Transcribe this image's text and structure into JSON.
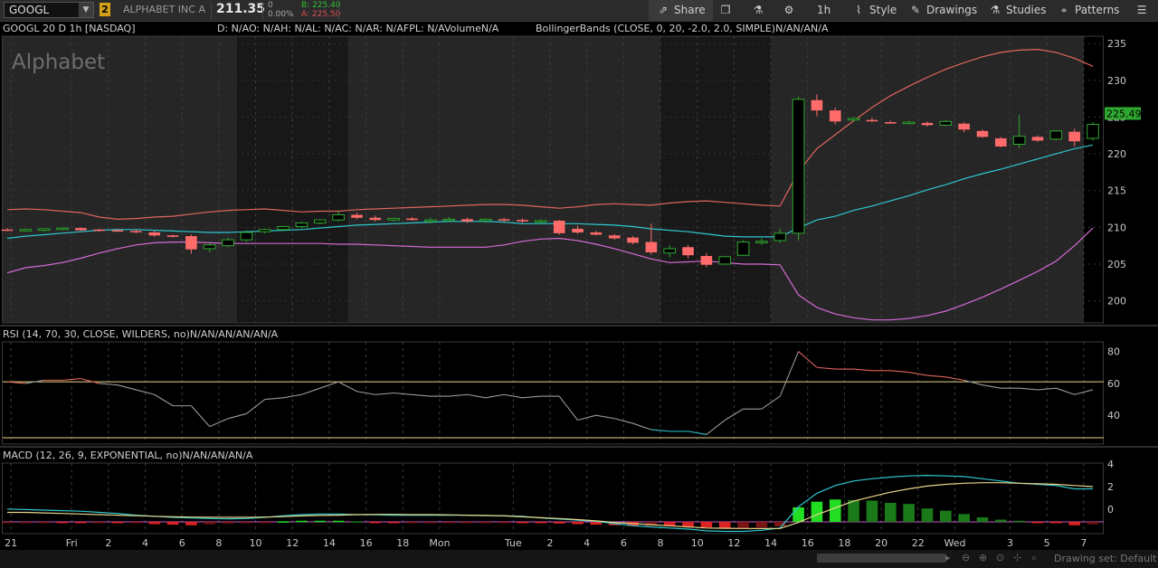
{
  "toolbar": {
    "symbol": "GOOGL",
    "link_badge": "2",
    "company": "ALPHABET INC A",
    "last_price": "211.35",
    "change": "0",
    "change_pct": "0.00%",
    "bid": "B: 225.40",
    "ask": "A: 225.50",
    "share_label": "Share",
    "timeframe_label": "1h",
    "style_label": "Style",
    "drawings_label": "Drawings",
    "studies_label": "Studies",
    "patterns_label": "Patterns",
    "icons": {
      "share": "share-icon",
      "window": "window-icon",
      "flask": "flask-icon",
      "settings": "gear-icon",
      "style": "style-icon",
      "drawings": "pencil-icon",
      "studies": "studies-icon",
      "patterns": "patterns-icon",
      "menu": "menu-icon"
    }
  },
  "header": {
    "chart_title": "GOOGL 20 D 1h [NASDAQ]",
    "quote_line": "D: N/AO: N/AH: N/AL: N/AC: N/AR: N/AFPL: N/AVolumeN/A",
    "study_line": "BollingerBands (CLOSE, 0, 20, -2.0, 2.0, SIMPLE)N/AN/AN/A",
    "watermark": "Alphabet"
  },
  "rsi_label": "RSI (14, 70, 30, CLOSE, WILDERS, no)N/AN/AN/AN/AN/A",
  "macd_label": "MACD (12, 26, 9, EXPONENTIAL, no)N/AN/AN/AN/A",
  "footer": {
    "drawing_set": "Drawing set: Default"
  },
  "colors": {
    "up": "#2fa82f",
    "down": "#ff6b6b",
    "bb_upper": "#e0655f",
    "bb_mid": "#2ec8d0",
    "bb_lower": "#d66ad6",
    "rsi": "#9a9a9a",
    "rsi_ob": "#e0655f",
    "rsi_os": "#2ec8d0",
    "band": "#e8d58a",
    "macd": "#2ec8d0",
    "signal": "#e8d58a",
    "hist_up": "#22dd22",
    "hist_up_dim": "#1a7a1a",
    "hist_dn": "#dd2222",
    "hist_dn_dim": "#7a1515"
  },
  "chart_data": [
    {
      "type": "candlestick",
      "title": "GOOGL 20 D 1h [NASDAQ]",
      "ylim": [
        197,
        236
      ],
      "y_ticks": [
        200,
        205,
        210,
        215,
        220,
        225,
        230,
        235
      ],
      "x_tick_labels": [
        "21",
        "Fri",
        "2",
        "4",
        "6",
        "8",
        "10",
        "12",
        "14",
        "16",
        "18",
        "Mon",
        "Tue",
        "2",
        "4",
        "6",
        "8",
        "10",
        "12",
        "14",
        "16",
        "18",
        "20",
        "22",
        "Wed",
        "3",
        "5",
        "7"
      ],
      "last_price_label": "225.49",
      "sessions": [
        {
          "type": "extended",
          "start": 0,
          "end": 13
        },
        {
          "type": "overnight",
          "start": 13,
          "end": 19
        },
        {
          "type": "regular",
          "start": 19,
          "end": 36
        },
        {
          "type": "overnight",
          "start": 36,
          "end": 42
        },
        {
          "type": "extended",
          "start": 42,
          "end": 59
        }
      ],
      "candles": [
        {
          "o": 209.7,
          "h": 209.9,
          "l": 209.5,
          "c": 209.6
        },
        {
          "o": 209.6,
          "h": 209.8,
          "l": 209.4,
          "c": 209.7
        },
        {
          "o": 209.6,
          "h": 209.9,
          "l": 209.4,
          "c": 209.8
        },
        {
          "o": 209.8,
          "h": 210.0,
          "l": 209.6,
          "c": 209.9
        },
        {
          "o": 209.9,
          "h": 210.0,
          "l": 209.5,
          "c": 209.6
        },
        {
          "o": 209.7,
          "h": 209.8,
          "l": 209.4,
          "c": 209.6
        },
        {
          "o": 209.6,
          "h": 209.8,
          "l": 209.4,
          "c": 209.5
        },
        {
          "o": 209.5,
          "h": 209.7,
          "l": 209.2,
          "c": 209.4
        },
        {
          "o": 209.3,
          "h": 209.5,
          "l": 208.7,
          "c": 208.9
        },
        {
          "o": 208.9,
          "h": 209.0,
          "l": 208.6,
          "c": 208.7
        },
        {
          "o": 208.8,
          "h": 209.0,
          "l": 206.4,
          "c": 207.0
        },
        {
          "o": 207.1,
          "h": 207.8,
          "l": 206.6,
          "c": 207.6
        },
        {
          "o": 207.5,
          "h": 208.6,
          "l": 207.3,
          "c": 208.3
        },
        {
          "o": 208.3,
          "h": 209.6,
          "l": 208.0,
          "c": 209.3
        },
        {
          "o": 209.4,
          "h": 209.8,
          "l": 209.2,
          "c": 209.7
        },
        {
          "o": 209.7,
          "h": 210.2,
          "l": 209.5,
          "c": 210.1
        },
        {
          "o": 210.1,
          "h": 210.7,
          "l": 209.9,
          "c": 210.6
        },
        {
          "o": 210.6,
          "h": 211.1,
          "l": 210.4,
          "c": 211.0
        },
        {
          "o": 211.0,
          "h": 212.2,
          "l": 210.8,
          "c": 211.7
        },
        {
          "o": 211.7,
          "h": 212.0,
          "l": 211.1,
          "c": 211.3
        },
        {
          "o": 211.3,
          "h": 211.6,
          "l": 210.8,
          "c": 211.0
        },
        {
          "o": 211.0,
          "h": 211.3,
          "l": 210.8,
          "c": 211.2
        },
        {
          "o": 211.2,
          "h": 211.4,
          "l": 210.9,
          "c": 211.0
        },
        {
          "o": 210.8,
          "h": 211.3,
          "l": 210.5,
          "c": 211.0
        },
        {
          "o": 211.0,
          "h": 211.4,
          "l": 210.8,
          "c": 211.1
        },
        {
          "o": 211.1,
          "h": 211.3,
          "l": 210.6,
          "c": 210.8
        },
        {
          "o": 210.9,
          "h": 211.2,
          "l": 210.6,
          "c": 211.1
        },
        {
          "o": 211.1,
          "h": 211.3,
          "l": 210.8,
          "c": 211.0
        },
        {
          "o": 211.0,
          "h": 211.2,
          "l": 210.6,
          "c": 210.8
        },
        {
          "o": 210.8,
          "h": 211.1,
          "l": 210.5,
          "c": 210.9
        },
        {
          "o": 210.9,
          "h": 211.0,
          "l": 209.0,
          "c": 209.2
        },
        {
          "o": 209.8,
          "h": 210.2,
          "l": 209.1,
          "c": 209.3
        },
        {
          "o": 209.3,
          "h": 209.5,
          "l": 208.9,
          "c": 209.0
        },
        {
          "o": 208.9,
          "h": 209.1,
          "l": 208.3,
          "c": 208.5
        },
        {
          "o": 208.6,
          "h": 208.8,
          "l": 207.7,
          "c": 207.9
        },
        {
          "o": 208.0,
          "h": 210.5,
          "l": 206.3,
          "c": 206.6
        },
        {
          "o": 206.5,
          "h": 207.6,
          "l": 205.9,
          "c": 207.1
        },
        {
          "o": 207.3,
          "h": 207.6,
          "l": 205.8,
          "c": 206.2
        },
        {
          "o": 206.1,
          "h": 206.5,
          "l": 204.6,
          "c": 204.9
        },
        {
          "o": 205.0,
          "h": 206.1,
          "l": 204.9,
          "c": 206.0
        },
        {
          "o": 206.2,
          "h": 208.2,
          "l": 206.1,
          "c": 208.0
        },
        {
          "o": 208.0,
          "h": 208.5,
          "l": 207.6,
          "c": 208.1
        },
        {
          "o": 208.2,
          "h": 209.8,
          "l": 207.9,
          "c": 209.2
        },
        {
          "o": 209.2,
          "h": 227.8,
          "l": 208.2,
          "c": 227.4
        },
        {
          "o": 227.3,
          "h": 228.1,
          "l": 225.1,
          "c": 225.9
        },
        {
          "o": 225.9,
          "h": 226.3,
          "l": 224.0,
          "c": 224.4
        },
        {
          "o": 224.6,
          "h": 225.0,
          "l": 224.4,
          "c": 224.8
        },
        {
          "o": 224.6,
          "h": 224.9,
          "l": 224.3,
          "c": 224.5
        },
        {
          "o": 224.3,
          "h": 224.5,
          "l": 224.1,
          "c": 224.2
        },
        {
          "o": 224.2,
          "h": 224.5,
          "l": 224.0,
          "c": 224.3
        },
        {
          "o": 224.2,
          "h": 224.4,
          "l": 223.7,
          "c": 223.9
        },
        {
          "o": 223.9,
          "h": 224.6,
          "l": 223.8,
          "c": 224.4
        },
        {
          "o": 224.1,
          "h": 224.3,
          "l": 222.9,
          "c": 223.3
        },
        {
          "o": 223.1,
          "h": 223.3,
          "l": 222.2,
          "c": 222.3
        },
        {
          "o": 222.1,
          "h": 222.3,
          "l": 220.9,
          "c": 221.0
        },
        {
          "o": 221.3,
          "h": 225.3,
          "l": 220.8,
          "c": 222.4
        },
        {
          "o": 222.3,
          "h": 222.5,
          "l": 221.6,
          "c": 221.8
        },
        {
          "o": 222.0,
          "h": 223.2,
          "l": 221.8,
          "c": 223.1
        },
        {
          "o": 223.0,
          "h": 223.4,
          "l": 221.0,
          "c": 221.7
        },
        {
          "o": 222.1,
          "h": 224.3,
          "l": 221.8,
          "c": 224.0
        }
      ],
      "bb_upper": [
        212.4,
        212.5,
        212.4,
        212.2,
        212.0,
        211.4,
        211.1,
        211.2,
        211.4,
        211.5,
        211.8,
        212.1,
        212.3,
        212.4,
        212.5,
        212.3,
        212.1,
        212.2,
        212.2,
        212.4,
        212.5,
        212.6,
        212.7,
        212.8,
        212.9,
        213.0,
        213.1,
        213.1,
        213.0,
        212.8,
        212.6,
        212.8,
        213.1,
        213.2,
        213.1,
        213.0,
        213.3,
        213.5,
        213.6,
        213.4,
        213.2,
        213.0,
        212.9,
        217.6,
        220.7,
        222.6,
        224.5,
        226.3,
        227.9,
        229.2,
        230.4,
        231.5,
        232.4,
        233.2,
        233.8,
        234.1,
        234.2,
        233.8,
        233.0,
        231.9
      ],
      "bb_mid": [
        208.5,
        208.8,
        209.0,
        209.2,
        209.4,
        209.6,
        209.7,
        209.7,
        209.6,
        209.5,
        209.4,
        209.3,
        209.3,
        209.4,
        209.5,
        209.6,
        209.7,
        209.9,
        210.1,
        210.3,
        210.4,
        210.5,
        210.6,
        210.7,
        210.8,
        210.8,
        210.8,
        210.7,
        210.5,
        210.5,
        210.5,
        210.5,
        210.4,
        210.3,
        210.1,
        209.8,
        209.6,
        209.4,
        209.1,
        208.8,
        208.7,
        208.7,
        208.7,
        209.9,
        211.0,
        211.5,
        212.3,
        212.9,
        213.6,
        214.3,
        215.1,
        215.8,
        216.6,
        217.3,
        217.9,
        218.6,
        219.3,
        220.0,
        220.7,
        221.2
      ],
      "bb_lower": [
        203.8,
        204.5,
        204.8,
        205.2,
        205.8,
        206.5,
        207.1,
        207.6,
        207.9,
        208.0,
        208.0,
        207.9,
        207.8,
        207.8,
        207.8,
        207.8,
        207.8,
        207.8,
        207.7,
        207.7,
        207.6,
        207.5,
        207.4,
        207.3,
        207.3,
        207.3,
        207.3,
        207.6,
        208.1,
        208.4,
        208.5,
        208.2,
        207.7,
        207.1,
        206.4,
        205.7,
        205.2,
        205.3,
        205.4,
        205.2,
        205.0,
        205.0,
        204.9,
        200.8,
        199.1,
        198.2,
        197.7,
        197.4,
        197.4,
        197.6,
        198.0,
        198.6,
        199.5,
        200.5,
        201.6,
        202.8,
        204.0,
        205.4,
        207.5,
        209.9
      ]
    },
    {
      "type": "line",
      "title": "RSI (14, 70, 30, CLOSE, WILDERS, no)",
      "ylim": [
        22,
        86
      ],
      "y_ticks": [
        40,
        60,
        80
      ],
      "overbought": 61,
      "oversold": 26,
      "values": [
        61,
        60,
        62,
        62,
        63,
        60,
        59,
        56,
        53,
        46,
        46,
        33,
        38,
        41,
        50,
        51,
        53,
        57,
        61,
        55,
        53,
        54,
        53,
        52,
        52,
        53,
        51,
        53,
        51,
        52,
        52,
        37,
        40,
        38,
        35,
        31,
        30,
        30,
        28,
        37,
        44,
        44,
        52,
        80,
        70,
        69,
        69,
        68,
        68,
        67,
        65,
        64,
        62,
        59,
        57,
        57,
        56,
        57,
        53,
        56
      ]
    },
    {
      "type": "bar+line",
      "title": "MACD (12, 26, 9, EXPONENTIAL, no)",
      "ylim": [
        -2.2,
        4.1
      ],
      "y_ticks": [
        0,
        2,
        4
      ],
      "macd": [
        0.0,
        -0.05,
        -0.1,
        -0.15,
        -0.2,
        -0.3,
        -0.4,
        -0.55,
        -0.65,
        -0.75,
        -0.8,
        -0.85,
        -0.88,
        -0.85,
        -0.75,
        -0.6,
        -0.5,
        -0.45,
        -0.45,
        -0.5,
        -0.52,
        -0.55,
        -0.55,
        -0.55,
        -0.55,
        -0.55,
        -0.6,
        -0.6,
        -0.65,
        -0.8,
        -0.9,
        -1.0,
        -1.1,
        -1.3,
        -1.5,
        -1.6,
        -1.7,
        -1.8,
        -1.95,
        -2.0,
        -2.0,
        -1.9,
        -1.7,
        0.2,
        1.4,
        2.1,
        2.5,
        2.7,
        2.85,
        2.95,
        3.0,
        2.95,
        2.9,
        2.7,
        2.5,
        2.3,
        2.2,
        2.1,
        1.8,
        1.8
      ],
      "signal": [
        -0.3,
        -0.3,
        -0.35,
        -0.4,
        -0.45,
        -0.5,
        -0.55,
        -0.6,
        -0.65,
        -0.7,
        -0.72,
        -0.74,
        -0.75,
        -0.75,
        -0.72,
        -0.68,
        -0.62,
        -0.58,
        -0.55,
        -0.5,
        -0.48,
        -0.48,
        -0.5,
        -0.5,
        -0.52,
        -0.55,
        -0.58,
        -0.62,
        -0.7,
        -0.78,
        -0.85,
        -0.95,
        -1.05,
        -1.2,
        -1.3,
        -1.4,
        -1.5,
        -1.6,
        -1.7,
        -1.72,
        -1.74,
        -1.75,
        -1.74,
        -1.2,
        -0.5,
        0.1,
        0.7,
        1.1,
        1.5,
        1.8,
        2.05,
        2.2,
        2.3,
        2.35,
        2.35,
        2.3,
        2.25,
        2.2,
        2.1,
        2.0
      ],
      "histogram": [
        -0.05,
        -0.05,
        -0.05,
        -0.08,
        -0.1,
        -0.1,
        -0.12,
        -0.12,
        -0.2,
        -0.25,
        -0.3,
        -0.2,
        -0.15,
        -0.1,
        -0.05,
        0.05,
        0.1,
        0.1,
        0.1,
        0.05,
        -0.02,
        -0.03,
        -0.03,
        -0.03,
        -0.03,
        -0.03,
        -0.03,
        -0.03,
        -0.05,
        -0.1,
        -0.15,
        -0.2,
        -0.25,
        -0.3,
        -0.35,
        -0.35,
        -0.4,
        -0.45,
        -0.5,
        -0.55,
        -0.55,
        -0.5,
        -0.4,
        1.3,
        1.8,
        2.0,
        1.95,
        1.9,
        1.7,
        1.6,
        1.2,
        1.0,
        0.7,
        0.4,
        0.2,
        0.1,
        -0.05,
        -0.1,
        -0.3,
        -0.2
      ]
    }
  ]
}
